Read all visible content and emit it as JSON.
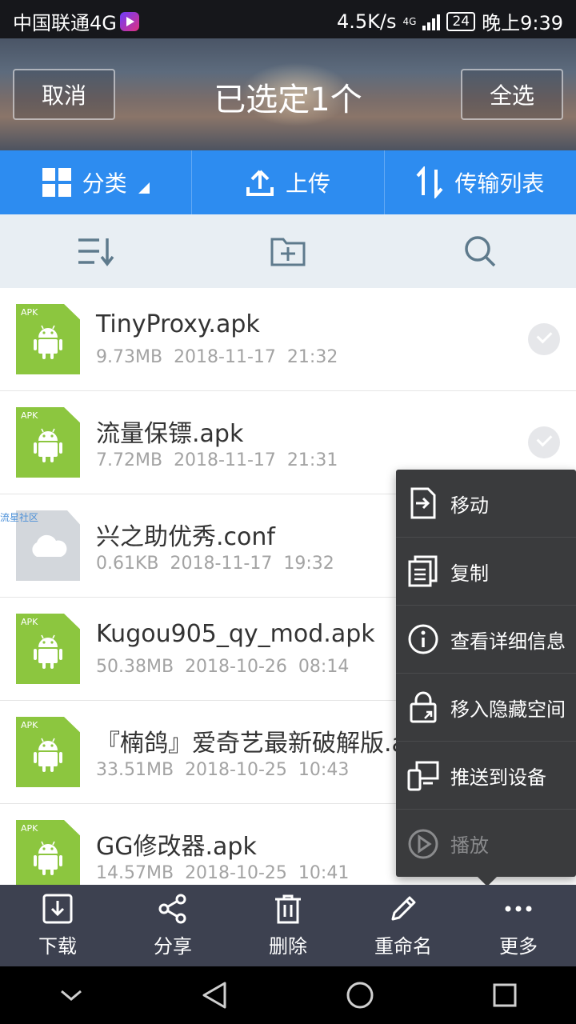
{
  "status_bar": {
    "carrier": "中国联通4G",
    "speed": "4.5K/s",
    "network": "4G",
    "battery": "24",
    "time": "晚上9:39"
  },
  "header": {
    "cancel_label": "取消",
    "title": "已选定1个",
    "select_all_label": "全选"
  },
  "tabs": [
    {
      "label": "分类",
      "icon": "grid-icon"
    },
    {
      "label": "上传",
      "icon": "upload-icon"
    },
    {
      "label": "传输列表",
      "icon": "transfer-icon"
    }
  ],
  "tools": [
    {
      "icon": "sort-icon"
    },
    {
      "icon": "new-folder-icon"
    },
    {
      "icon": "search-icon"
    }
  ],
  "files": [
    {
      "name": "TinyProxy.apk",
      "size": "9.73MB",
      "date": "2018-11-17",
      "time": "21:32",
      "type": "apk",
      "selected": false
    },
    {
      "name": "流量保镖.apk",
      "size": "7.72MB",
      "date": "2018-11-17",
      "time": "21:31",
      "type": "apk",
      "selected": false
    },
    {
      "name": "兴之助优秀.conf",
      "size": "0.61KB",
      "date": "2018-11-17",
      "time": "19:32",
      "type": "cloud",
      "selected": true,
      "watermark": "流星社区"
    },
    {
      "name": "Kugou905_qy_mod.apk",
      "size": "50.38MB",
      "date": "2018-10-26",
      "time": "08:14",
      "type": "apk",
      "selected": false
    },
    {
      "name": "『楠鸽』爱奇艺最新破解版.apk",
      "size": "33.51MB",
      "date": "2018-10-25",
      "time": "10:43",
      "type": "apk",
      "selected": false
    },
    {
      "name": "GG修改器.apk",
      "size": "14.57MB",
      "date": "2018-10-25",
      "time": "10:41",
      "type": "apk",
      "selected": false
    }
  ],
  "apk_label": "APK",
  "menu": [
    {
      "label": "移动",
      "icon": "move-icon",
      "enabled": true
    },
    {
      "label": "复制",
      "icon": "copy-icon",
      "enabled": true
    },
    {
      "label": "查看详细信息",
      "icon": "info-icon",
      "enabled": true
    },
    {
      "label": "移入隐藏空间",
      "icon": "lock-icon",
      "enabled": true
    },
    {
      "label": "推送到设备",
      "icon": "devices-icon",
      "enabled": true
    },
    {
      "label": "播放",
      "icon": "play-icon",
      "enabled": false
    }
  ],
  "actions": [
    {
      "label": "下载",
      "icon": "download-icon"
    },
    {
      "label": "分享",
      "icon": "share-icon"
    },
    {
      "label": "删除",
      "icon": "trash-icon"
    },
    {
      "label": "重命名",
      "icon": "pencil-icon"
    },
    {
      "label": "更多",
      "icon": "more-icon"
    }
  ],
  "colors": {
    "accent": "#2d8cf0",
    "apk_green": "#8cc63f",
    "action_bar": "#3d4150",
    "menu_bg": "#3a3b3d"
  }
}
